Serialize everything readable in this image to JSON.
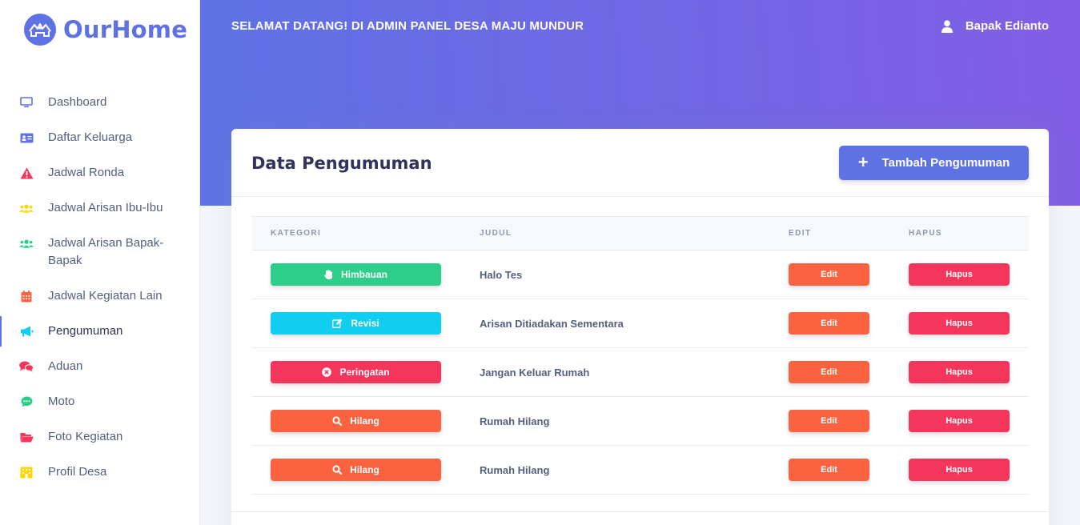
{
  "brand": {
    "name": "OurHome",
    "color": "#5e72e4"
  },
  "header": {
    "welcome": "SELAMAT DATANG! DI ADMIN PANEL DESA MAJU MUNDUR",
    "user_name": "Bapak Edianto",
    "user_icon": "user-icon"
  },
  "sidebar": {
    "items": [
      {
        "label": "Dashboard",
        "icon": "monitor-icon",
        "color": "#5e72e4"
      },
      {
        "label": "Daftar Keluarga",
        "icon": "id-card-icon",
        "color": "#5e72e4"
      },
      {
        "label": "Jadwal Ronda",
        "icon": "warning-icon",
        "color": "#f5365c"
      },
      {
        "label": "Jadwal Arisan Ibu-Ibu",
        "icon": "users-icon",
        "color": "#ffd600"
      },
      {
        "label": "Jadwal Arisan Bapak-Bapak",
        "icon": "users-icon",
        "color": "#2dce89"
      },
      {
        "label": "Jadwal Kegiatan Lain",
        "icon": "calendar-icon",
        "color": "#fb6340"
      },
      {
        "label": "Pengumuman",
        "icon": "megaphone-icon",
        "color": "#11cdef",
        "active": true
      },
      {
        "label": "Aduan",
        "icon": "comments-icon",
        "color": "#f5365c"
      },
      {
        "label": "Moto",
        "icon": "chat-bubble-icon",
        "color": "#2dce89"
      },
      {
        "label": "Foto Kegiatan",
        "icon": "folder-open-icon",
        "color": "#f5365c"
      },
      {
        "label": "Profil Desa",
        "icon": "building-icon",
        "color": "#ffd600"
      }
    ]
  },
  "card": {
    "title": "Data Pengumuman",
    "add_button": "Tambah Pengumuman",
    "columns": [
      "KATEGORI",
      "JUDUL",
      "EDIT",
      "HAPUS"
    ],
    "rows": [
      {
        "kategori": "Himbauan",
        "icon": "hand-icon",
        "color": "#2dce89",
        "judul": "Halo Tes",
        "edit": "Edit",
        "hapus": "Hapus"
      },
      {
        "kategori": "Revisi",
        "icon": "edit-icon",
        "color": "#11cdef",
        "judul": "Arisan Ditiadakan Sementara",
        "edit": "Edit",
        "hapus": "Hapus"
      },
      {
        "kategori": "Peringatan",
        "icon": "times-circle-icon",
        "color": "#f5365c",
        "judul": "Jangan Keluar Rumah",
        "edit": "Edit",
        "hapus": "Hapus"
      },
      {
        "kategori": "Hilang",
        "icon": "search-icon",
        "color": "#fb6340",
        "judul": "Rumah Hilang",
        "edit": "Edit",
        "hapus": "Hapus"
      },
      {
        "kategori": "Hilang",
        "icon": "search-icon",
        "color": "#fb6340",
        "judul": "Rumah Hilang",
        "edit": "Edit",
        "hapus": "Hapus"
      }
    ]
  },
  "colors": {
    "primary": "#5e72e4",
    "gradient_end": "#825ee4",
    "edit": "#fb6340",
    "delete": "#f5365c"
  }
}
